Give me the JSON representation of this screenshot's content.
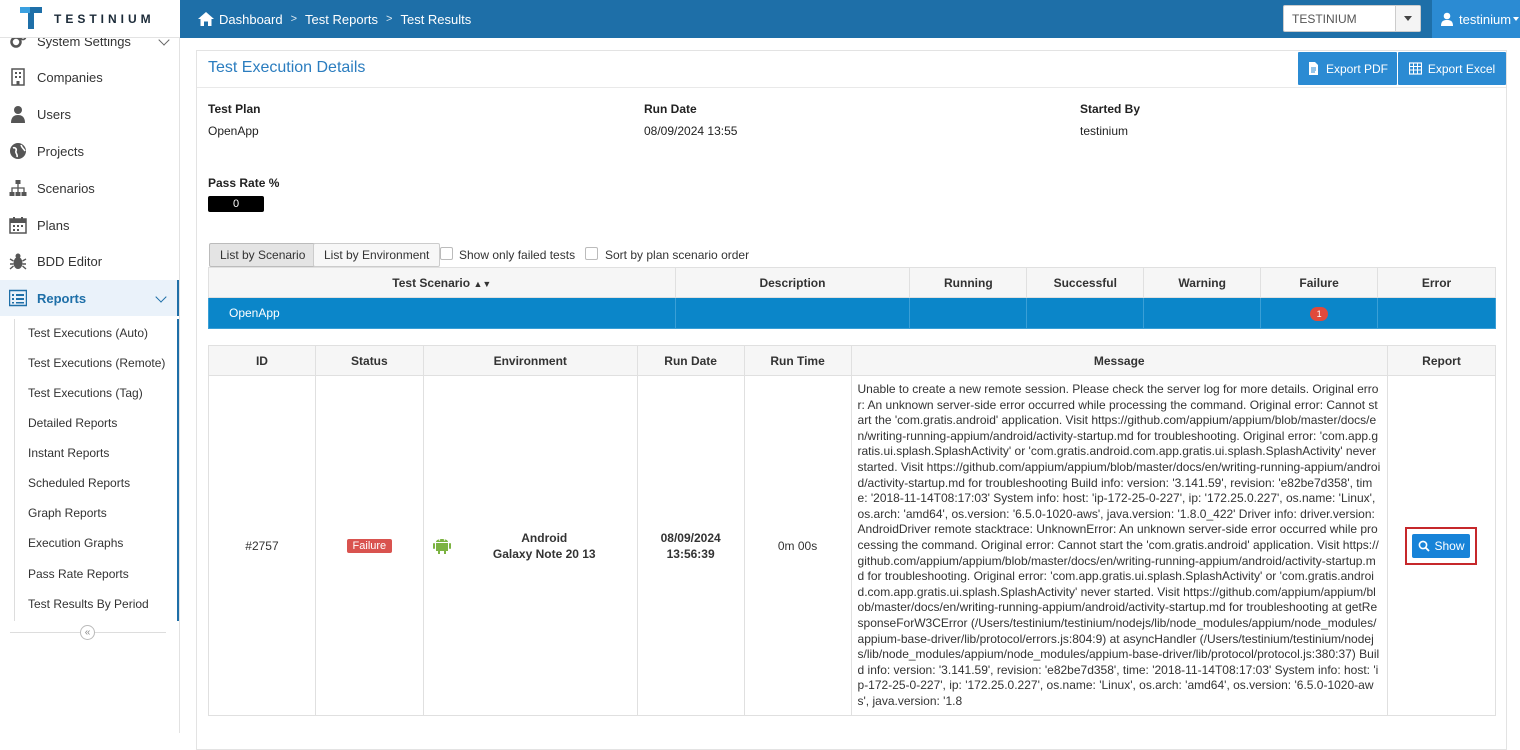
{
  "app": {
    "logo_text": "TESTINIUM"
  },
  "breadcrumb": [
    "Dashboard",
    "Test Reports",
    "Test Results"
  ],
  "org_select": {
    "value": "TESTINIUM"
  },
  "user": {
    "name": "testinium"
  },
  "sidebar": {
    "items": [
      {
        "label": "System Settings",
        "icon": "gears-icon"
      },
      {
        "label": "Companies",
        "icon": "building-icon"
      },
      {
        "label": "Users",
        "icon": "user-icon"
      },
      {
        "label": "Projects",
        "icon": "globe-icon"
      },
      {
        "label": "Scenarios",
        "icon": "sitemap-icon"
      },
      {
        "label": "Plans",
        "icon": "calendar-icon"
      },
      {
        "label": "BDD Editor",
        "icon": "bug-icon"
      },
      {
        "label": "Reports",
        "icon": "report-list-icon"
      }
    ],
    "sub_items": [
      "Test Executions (Auto)",
      "Test Executions (Remote)",
      "Test Executions (Tag)",
      "Detailed Reports",
      "Instant Reports",
      "Scheduled Reports",
      "Graph Reports",
      "Execution Graphs",
      "Pass Rate Reports",
      "Test Results By Period"
    ]
  },
  "panel": {
    "title": "Test Execution Details",
    "export_pdf": "Export PDF",
    "export_excel": "Export Excel",
    "test_plan_label": "Test Plan",
    "test_plan_value": "OpenApp",
    "run_date_label": "Run Date",
    "run_date_value": "08/09/2024 13:55",
    "started_by_label": "Started By",
    "started_by_value": "testinium",
    "pass_rate_label": "Pass Rate %",
    "pass_rate_value": "0"
  },
  "tabs": {
    "by_scenario": "List by Scenario",
    "by_environment": "List by Environment"
  },
  "filters": {
    "only_failed": "Show only failed tests",
    "sort_plan": "Sort by plan scenario order"
  },
  "scenario_table": {
    "headers": [
      "Test Scenario",
      "Description",
      "Running",
      "Successful",
      "Warning",
      "Failure",
      "Error"
    ],
    "row": {
      "name": "OpenApp",
      "failure_count": "1"
    }
  },
  "results_table": {
    "headers": [
      "ID",
      "Status",
      "Environment",
      "Run Date",
      "Run Time",
      "Message",
      "Report"
    ],
    "row": {
      "id": "#2757",
      "status": "Failure",
      "env_line1": "Android",
      "env_line2": "Galaxy Note 20 13",
      "run_date_line1": "08/09/2024",
      "run_date_line2": "13:56:39",
      "run_time": "0m 00s",
      "message": "Unable to create a new remote session. Please check the server log for more details. Original error: An unknown server-side error occurred while processing the command. Original error: Cannot start the 'com.gratis.android' application. Visit https://github.com/appium/appium/blob/master/docs/en/writing-running-appium/android/activity-startup.md for troubleshooting. Original error: 'com.app.gratis.ui.splash.SplashActivity' or 'com.gratis.android.com.app.gratis.ui.splash.SplashActivity' never started. Visit https://github.com/appium/appium/blob/master/docs/en/writing-running-appium/android/activity-startup.md for troubleshooting Build info: version: '3.141.59', revision: 'e82be7d358', time: '2018-11-14T08:17:03' System info: host: 'ip-172-25-0-227', ip: '172.25.0.227', os.name: 'Linux', os.arch: 'amd64', os.version: '6.5.0-1020-aws', java.version: '1.8.0_422' Driver info: driver.version: AndroidDriver remote stacktrace: UnknownError: An unknown server-side error occurred while processing the command. Original error: Cannot start the 'com.gratis.android' application. Visit https://github.com/appium/appium/blob/master/docs/en/writing-running-appium/android/activity-startup.md for troubleshooting. Original error: 'com.app.gratis.ui.splash.SplashActivity' or 'com.gratis.android.com.app.gratis.ui.splash.SplashActivity' never started. Visit https://github.com/appium/appium/blob/master/docs/en/writing-running-appium/android/activity-startup.md for troubleshooting at getResponseForW3CError (/Users/testinium/testinium/nodejs/lib/node_modules/appium/node_modules/appium-base-driver/lib/protocol/errors.js:804:9) at asyncHandler (/Users/testinium/testinium/nodejs/lib/node_modules/appium/node_modules/appium-base-driver/lib/protocol/protocol.js:380:37) Build info: version: '3.141.59', revision: 'e82be7d358', time: '2018-11-14T08:17:03' System info: host: 'ip-172-25-0-227', ip: '172.25.0.227', os.name: 'Linux', os.arch: 'amd64', os.version: '6.5.0-1020-aws', java.version: '1.8",
      "report_button": "Show"
    }
  },
  "colors": {
    "header": "#1e6fa8",
    "accent": "#2b8bd3",
    "failure": "#d9534f"
  }
}
